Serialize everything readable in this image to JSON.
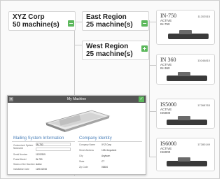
{
  "hierarchy": {
    "root": {
      "name": "XYZ Corp",
      "count": "50 machine(s)",
      "btn": "−"
    },
    "regions": [
      {
        "name": "East Region",
        "count": "25 machine(s)",
        "btn": "−"
      },
      {
        "name": "West Region",
        "count": "25 machine(s)",
        "btn": "+"
      }
    ]
  },
  "devices": [
    {
      "model": "IN-750",
      "serial": "11202515",
      "status": "ACTIVE",
      "sub": "IN-750",
      "icon": "postage-meter-icon"
    },
    {
      "model": "IN 360",
      "serial": "10246810",
      "status": "ACTIVE",
      "sub": "IN-360",
      "icon": "postage-meter-icon"
    },
    {
      "model": "IS5000",
      "serial": "17268763",
      "status": "ACTIVE",
      "sub": "IS5000",
      "icon": "postage-meter-icon"
    },
    {
      "model": "IS6000",
      "serial": "17280149",
      "status": "ACTIVE",
      "sub": "IS6000",
      "icon": "postage-meter-icon"
    }
  ],
  "modal": {
    "title": "My Machine",
    "close": "×",
    "ok": "✓",
    "left_section": {
      "title": "Mailing System Information",
      "rows": [
        {
          "label": "Customized System Nickname",
          "value": "IN-750",
          "input": true
        },
        {
          "label": "Serial Number",
          "value": "11202515"
        },
        {
          "label": "Postal Model",
          "value": "IN-750"
        },
        {
          "label": "Status of the Machine",
          "value": "Active"
        },
        {
          "label": "Installation Date",
          "value": "12/01/2015"
        }
      ]
    },
    "right_section": {
      "title": "Company Identity",
      "rows": [
        {
          "label": "Company Name",
          "value": "XYZ Corp"
        },
        {
          "label": "Street Address",
          "value": "1234 Anystreet"
        },
        {
          "label": "City",
          "value": "Anytown"
        },
        {
          "label": "State",
          "value": "CT"
        },
        {
          "label": "Zip Code",
          "value": "06484"
        }
      ]
    }
  },
  "colors": {
    "accent_green": "#5cb85c",
    "section_blue": "#4a7fb8",
    "modal_header": "#555555"
  }
}
